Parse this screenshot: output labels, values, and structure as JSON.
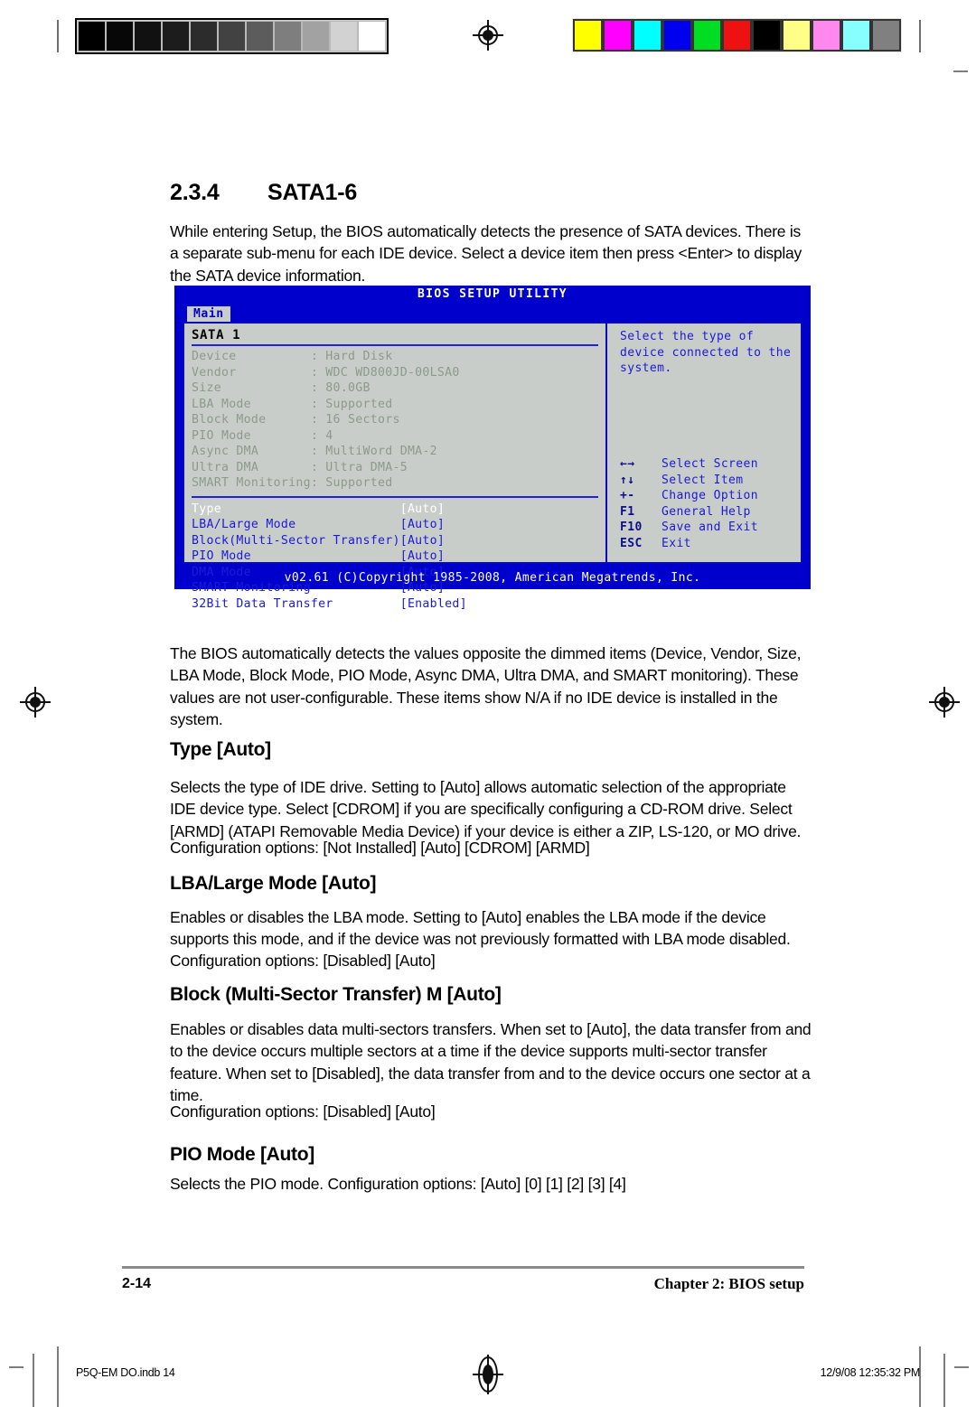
{
  "print_marks": {
    "gray_wedge": [
      "#000000",
      "#070707",
      "#111111",
      "#1c1c1c",
      "#2c2c2c",
      "#424242",
      "#5c5c5c",
      "#7e7e7e",
      "#a2a2a2",
      "#d2d2d2",
      "#ffffff"
    ],
    "color_bar": [
      "#ffff00",
      "#ff00ff",
      "#00ffff",
      "#0000ee",
      "#00dd22",
      "#ee1111",
      "#000000",
      "#ffff88",
      "#ff88ee",
      "#88ffff",
      "#808080"
    ],
    "registration_icon": "registration-target-icon"
  },
  "section": {
    "number": "2.3.4",
    "title": "SATA1-6",
    "intro": "While entering Setup, the BIOS automatically detects the presence of SATA devices. There is a separate sub-menu for each IDE device. Select a device item then press <Enter> to display the SATA device information."
  },
  "bios": {
    "title": "BIOS SETUP UTILITY",
    "tab": "Main",
    "panel_heading": "SATA 1",
    "info_rows": [
      {
        "label": "Device",
        "sep": ":",
        "value": "Hard Disk"
      },
      {
        "label": "Vendor",
        "sep": ":",
        "value": "WDC WD800JD-00LSA0"
      },
      {
        "label": "Size",
        "sep": ":",
        "value": "80.0GB"
      },
      {
        "label": "LBA Mode",
        "sep": ":",
        "value": "Supported"
      },
      {
        "label": "Block Mode",
        "sep": ":",
        "value": "16 Sectors"
      },
      {
        "label": "PIO Mode",
        "sep": ":",
        "value": "4"
      },
      {
        "label": "Async DMA",
        "sep": ":",
        "value": "MultiWord DMA-2"
      },
      {
        "label": "Ultra DMA",
        "sep": ":",
        "value": "Ultra DMA-5"
      }
    ],
    "smart_line": "SMART Monitoring: Supported",
    "option_rows": [
      {
        "label": "Type",
        "value": "[Auto]",
        "selected": true
      },
      {
        "label": "LBA/Large Mode",
        "value": "[Auto]",
        "selected": false
      },
      {
        "label": "Block(Multi-Sector Transfer)M",
        "value": "[Auto]",
        "selected": false
      },
      {
        "label": "PIO Mode",
        "value": "[Auto]",
        "selected": false
      },
      {
        "label": "DMA Mode",
        "value": "[Auto]",
        "selected": false
      },
      {
        "label": "SMART Monitoring",
        "value": "[Auto]",
        "selected": false
      },
      {
        "label": "32Bit Data Transfer",
        "value": "[Enabled]",
        "selected": false
      }
    ],
    "help": "Select the type of device connected to the system.",
    "keys": [
      {
        "key": "←→",
        "desc": "Select Screen"
      },
      {
        "key": "↑↓",
        "desc": "Select Item"
      },
      {
        "key": "+-",
        "desc": "Change Option"
      },
      {
        "key": "F1",
        "desc": "General Help"
      },
      {
        "key": "F10",
        "desc": "Save and Exit"
      },
      {
        "key": "ESC",
        "desc": "Exit"
      }
    ],
    "footer": "v02.61 (C)Copyright 1985-2008, American Megatrends, Inc.",
    "colors": {
      "background": "#0000cc",
      "panel": "#c9cdc9",
      "border": "#0a0ab5",
      "option_text": "#1b1bd6",
      "dimmed_text": "#8c9a8c",
      "selected_text": "#ffffff"
    }
  },
  "body": {
    "detect_note": "The BIOS automatically detects the values opposite the dimmed items (Device, Vendor, Size, LBA Mode, Block Mode, PIO Mode, Async DMA, Ultra DMA, and SMART monitoring). These values are not user-configurable. These items show N/A if no IDE device is installed in the system."
  },
  "items": [
    {
      "heading": "Type [Auto]",
      "paragraphs": [
        "Selects the type of IDE drive. Setting to [Auto] allows automatic selection of the appropriate IDE device type. Select [CDROM] if you are specifically configuring a CD-ROM drive. Select [ARMD] (ATAPI Removable Media Device) if your device is either a ZIP, LS-120, or MO drive.",
        "Configuration options: [Not Installed] [Auto] [CDROM] [ARMD]"
      ]
    },
    {
      "heading": "LBA/Large Mode [Auto]",
      "paragraphs": [
        "Enables or disables the LBA mode. Setting to [Auto] enables the LBA mode if the device supports this mode, and if the device was not previously formatted with LBA mode disabled.",
        "Configuration options: [Disabled] [Auto]"
      ]
    },
    {
      "heading": "Block (Multi-Sector Transfer) M [Auto]",
      "paragraphs": [
        "Enables or disables data multi-sectors transfers. When set to [Auto], the data transfer from and to the device occurs multiple sectors at a time if the device supports multi-sector transfer feature. When set to [Disabled], the data transfer from and to the device occurs one sector at a time.",
        "Configuration options: [Disabled] [Auto]"
      ]
    },
    {
      "heading": "PIO Mode [Auto]",
      "paragraphs": [
        "Selects the PIO mode. Configuration options: [Auto] [0] [1] [2] [3] [4]"
      ]
    }
  ],
  "footer": {
    "page_number": "2-14",
    "chapter": "Chapter 2: BIOS setup",
    "slug_file": "P5Q-EM DO.indb   14",
    "slug_date": "12/9/08   12:35:32 PM"
  }
}
